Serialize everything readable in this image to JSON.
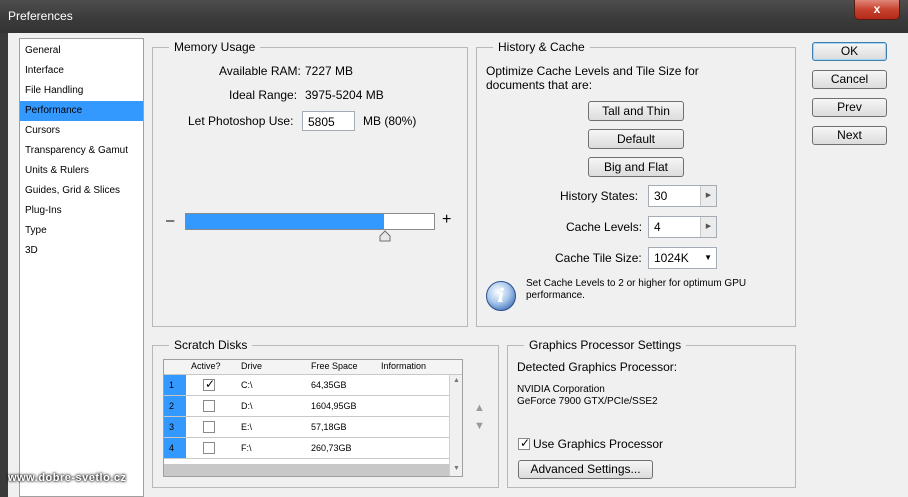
{
  "window": {
    "title": "Preferences",
    "close_glyph": "x"
  },
  "nav": {
    "items": [
      "General",
      "Interface",
      "File Handling",
      "Performance",
      "Cursors",
      "Transparency & Gamut",
      "Units & Rulers",
      "Guides, Grid & Slices",
      "Plug-Ins",
      "Type",
      "3D"
    ],
    "selected": "Performance"
  },
  "memory": {
    "title": "Memory Usage",
    "available_label": "Available RAM:",
    "available_value": "7227 MB",
    "ideal_label": "Ideal Range:",
    "ideal_value": "3975-5204 MB",
    "use_label": "Let Photoshop Use:",
    "use_value": "5805",
    "use_unit": "MB (80%)",
    "minus": "–",
    "plus": "+",
    "slider_fraction": 0.8
  },
  "history": {
    "title": "History & Cache",
    "desc_line1": "Optimize Cache Levels and Tile Size for",
    "desc_line2": "documents that are:",
    "tall_thin": "Tall and Thin",
    "default": "Default",
    "big_flat": "Big and Flat",
    "states_label": "History States:",
    "states_value": "30",
    "levels_label": "Cache Levels:",
    "levels_value": "4",
    "tile_label": "Cache Tile Size:",
    "tile_value": "1024K",
    "info_line1": "Set Cache Levels to 2 or higher for optimum GPU",
    "info_line2": "performance.",
    "info_glyph": "i"
  },
  "scratch": {
    "title": "Scratch Disks",
    "headers": {
      "active": "Active?",
      "drive": "Drive",
      "free": "Free Space",
      "info": "Information"
    },
    "rows": [
      {
        "num": "1",
        "active": true,
        "drive": "C:\\",
        "free": "64,35GB",
        "info": ""
      },
      {
        "num": "2",
        "active": false,
        "drive": "D:\\",
        "free": "1604,95GB",
        "info": ""
      },
      {
        "num": "3",
        "active": false,
        "drive": "E:\\",
        "free": "57,18GB",
        "info": ""
      },
      {
        "num": "4",
        "active": false,
        "drive": "F:\\",
        "free": "260,73GB",
        "info": ""
      }
    ],
    "up_glyph": "▲",
    "down_glyph": "▼"
  },
  "gpu": {
    "title": "Graphics Processor Settings",
    "detected_label": "Detected Graphics Processor:",
    "vendor": "NVIDIA Corporation",
    "model": "GeForce 7900 GTX/PCIe/SSE2",
    "use_label": "Use Graphics Processor",
    "use_checked": true,
    "advanced_label": "Advanced Settings..."
  },
  "buttons": {
    "ok": "OK",
    "cancel": "Cancel",
    "prev": "Prev",
    "next": "Next"
  },
  "watermark": "www.dobre-svetlo.cz",
  "colors": {
    "selection": "#3399ff",
    "titlebar": "#3a3a3a",
    "close": "#c7432f"
  }
}
